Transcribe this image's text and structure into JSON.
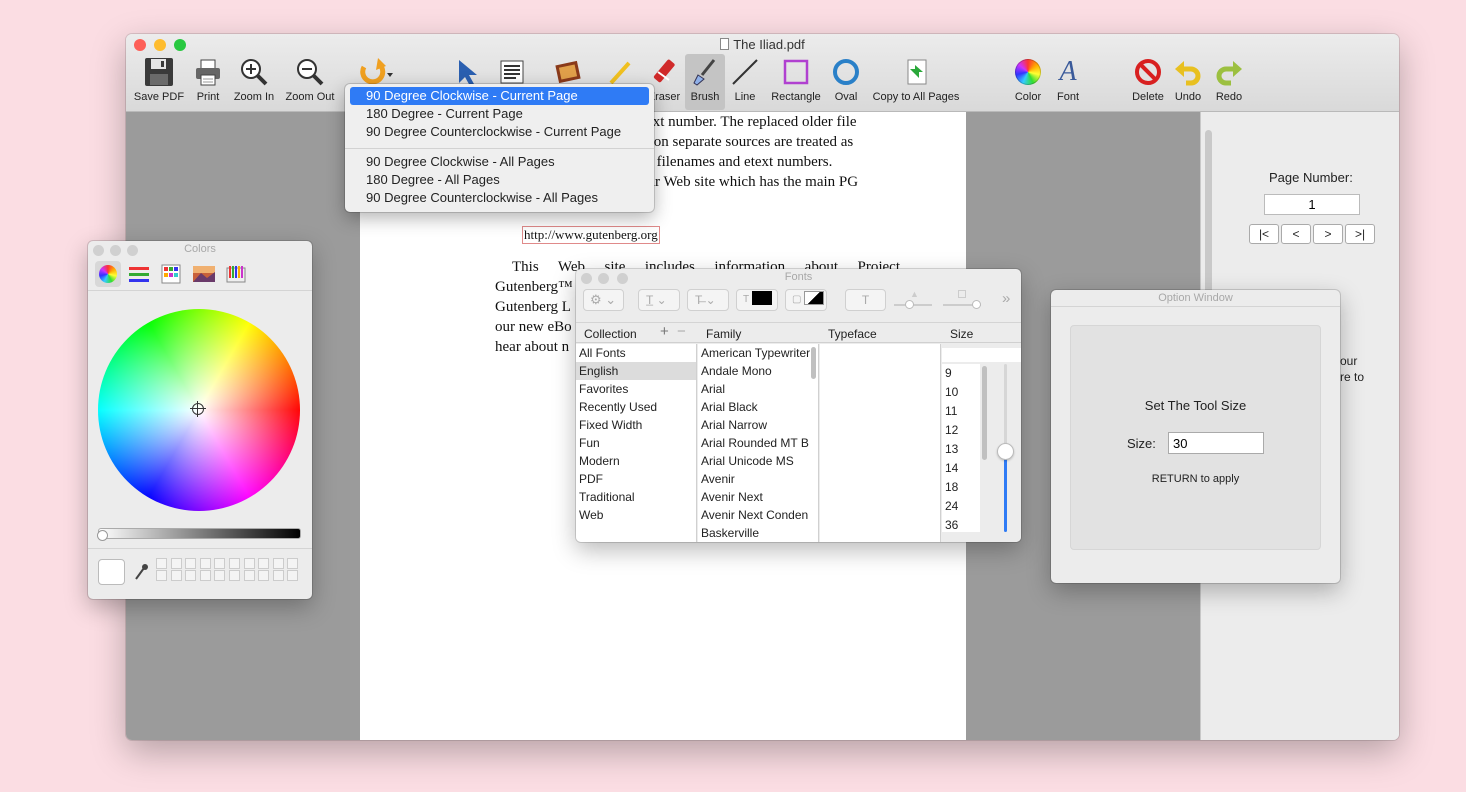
{
  "window": {
    "title": "The Iliad.pdf"
  },
  "toolbar": {
    "save_pdf": "Save PDF",
    "print": "Print",
    "zoom_in": "Zoom In",
    "zoom_out": "Zoom Out",
    "eraser": "Eraser",
    "brush": "Brush",
    "line": "Line",
    "rectangle": "Rectangle",
    "oval": "Oval",
    "copy_to_all": "Copy to All Pages",
    "color": "Color",
    "font": "Font",
    "delete": "Delete",
    "undo": "Undo",
    "redo": "Redo"
  },
  "rotate_menu": {
    "items": [
      "90 Degree Clockwise - Current Page",
      "180 Degree - Current Page",
      "90 Degree Counterclockwise - Current Page",
      "90 Degree Clockwise - All Pages",
      "180 Degree - All Pages",
      "90 Degree Counterclockwise - All Pages"
    ]
  },
  "document": {
    "lines": [
      "d etext number. The replaced older file",
      "sed on separate sources are treated as",
      "w filenames and etext numbers.",
      "our Web site which has the main PG"
    ],
    "link": "http://www.gutenberg.org",
    "para2_line1": "This Web site includes information about Project",
    "para2_rest": [
      "Gutenberg™",
      "Gutenberg L",
      "our new eBo",
      "hear about n"
    ]
  },
  "right_panel": {
    "page_label": "Page Number:",
    "page_value": "1",
    "nav": [
      "|<",
      "<",
      ">",
      ">|"
    ],
    "partial_text": [
      "our",
      "re to"
    ]
  },
  "colors_panel": {
    "title": "Colors"
  },
  "fonts_panel": {
    "title": "Fonts",
    "headers": {
      "collection": "Collection",
      "family": "Family",
      "typeface": "Typeface",
      "size": "Size"
    },
    "collections": [
      "All Fonts",
      "English",
      "Favorites",
      "Recently Used",
      "Fixed Width",
      "Fun",
      "Modern",
      "PDF",
      "Traditional",
      "Web"
    ],
    "selected_collection": "English",
    "families": [
      "American Typewriter",
      "Andale Mono",
      "Arial",
      "Arial Black",
      "Arial Narrow",
      "Arial Rounded MT B",
      "Arial Unicode MS",
      "Avenir",
      "Avenir Next",
      "Avenir Next Conden",
      "Baskerville"
    ],
    "sizes": [
      "9",
      "10",
      "11",
      "12",
      "13",
      "14",
      "18",
      "24",
      "36"
    ]
  },
  "option_window": {
    "title": "Option Window",
    "heading": "Set The Tool Size",
    "size_label": "Size:",
    "size_value": "30",
    "hint": "RETURN to apply"
  },
  "accent": "#2f7bf5"
}
